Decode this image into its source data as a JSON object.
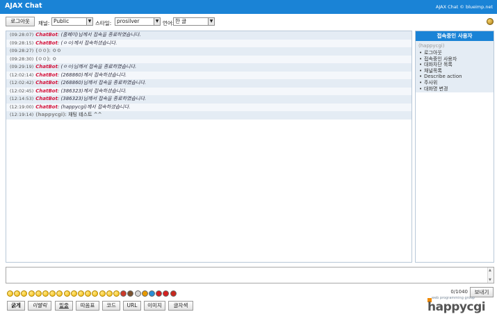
{
  "header": {
    "title": "AJAX Chat",
    "copyright": "AJAX Chat © blueimp.net"
  },
  "toolbar": {
    "logout_label": "로그아웃",
    "channel_label": "채널:",
    "channel_value": "Public",
    "style_label": "스타일:",
    "style_value": "prosilver",
    "language_label": "언어:",
    "language_value": "한 글"
  },
  "messages": [
    {
      "time": "(09:28:07)",
      "name": "ChatBot",
      "text": ": (홈페이)님께서 접속을 종료하였습니다.",
      "bot": true
    },
    {
      "time": "(09:28:15)",
      "name": "ChatBot",
      "text": ": (ㅇㅇ)께서 접속하셨습니다.",
      "bot": true
    },
    {
      "time": "(09:28:27)",
      "name": "(ㅇㅇ)",
      "text": ": ㅇㅇ",
      "bot": false
    },
    {
      "time": "(09:28:30)",
      "name": "(ㅇㅇ)",
      "text": ": ㅇ",
      "bot": false
    },
    {
      "time": "(09:29:19)",
      "name": "ChatBot",
      "text": ": (ㅇㅇ)님께서 접속을 종료하였습니다.",
      "bot": true
    },
    {
      "time": "(12:02:14)",
      "name": "ChatBot",
      "text": ": (268860)께서 접속하셨습니다.",
      "bot": true
    },
    {
      "time": "(12:02:42)",
      "name": "ChatBot",
      "text": ": (268860)님께서 접속을 종료하였습니다.",
      "bot": true
    },
    {
      "time": "(12:02:45)",
      "name": "ChatBot",
      "text": ": (386323)께서 접속하셨습니다.",
      "bot": true
    },
    {
      "time": "(12:14:53)",
      "name": "ChatBot",
      "text": ": (386323)님께서 접속을 종료하였습니다.",
      "bot": true
    },
    {
      "time": "(12:19:00)",
      "name": "ChatBot",
      "text": ": (happycgi)께서 접속하셨습니다.",
      "bot": true
    },
    {
      "time": "(12:19:14)",
      "name": "(happycgi)",
      "text": ": 채팅 테스트 ^^",
      "bot": false
    }
  ],
  "online": {
    "title": "접속중인 사용자",
    "user": "(happycgi)",
    "menu": [
      "로그아웃",
      "접속중인 사용자",
      "대화차단 목록",
      "채널목록",
      "Describe action",
      "주사위",
      "대화명 변경"
    ]
  },
  "counter": "0/1040",
  "send_label": "보내기",
  "format_buttons": [
    "굵게",
    "이탤릭",
    "밑줄",
    "따옴표",
    "코드",
    "URL",
    "이미지",
    "글자색"
  ],
  "logo": {
    "tagline": "web programming group",
    "text": "happycgi"
  }
}
